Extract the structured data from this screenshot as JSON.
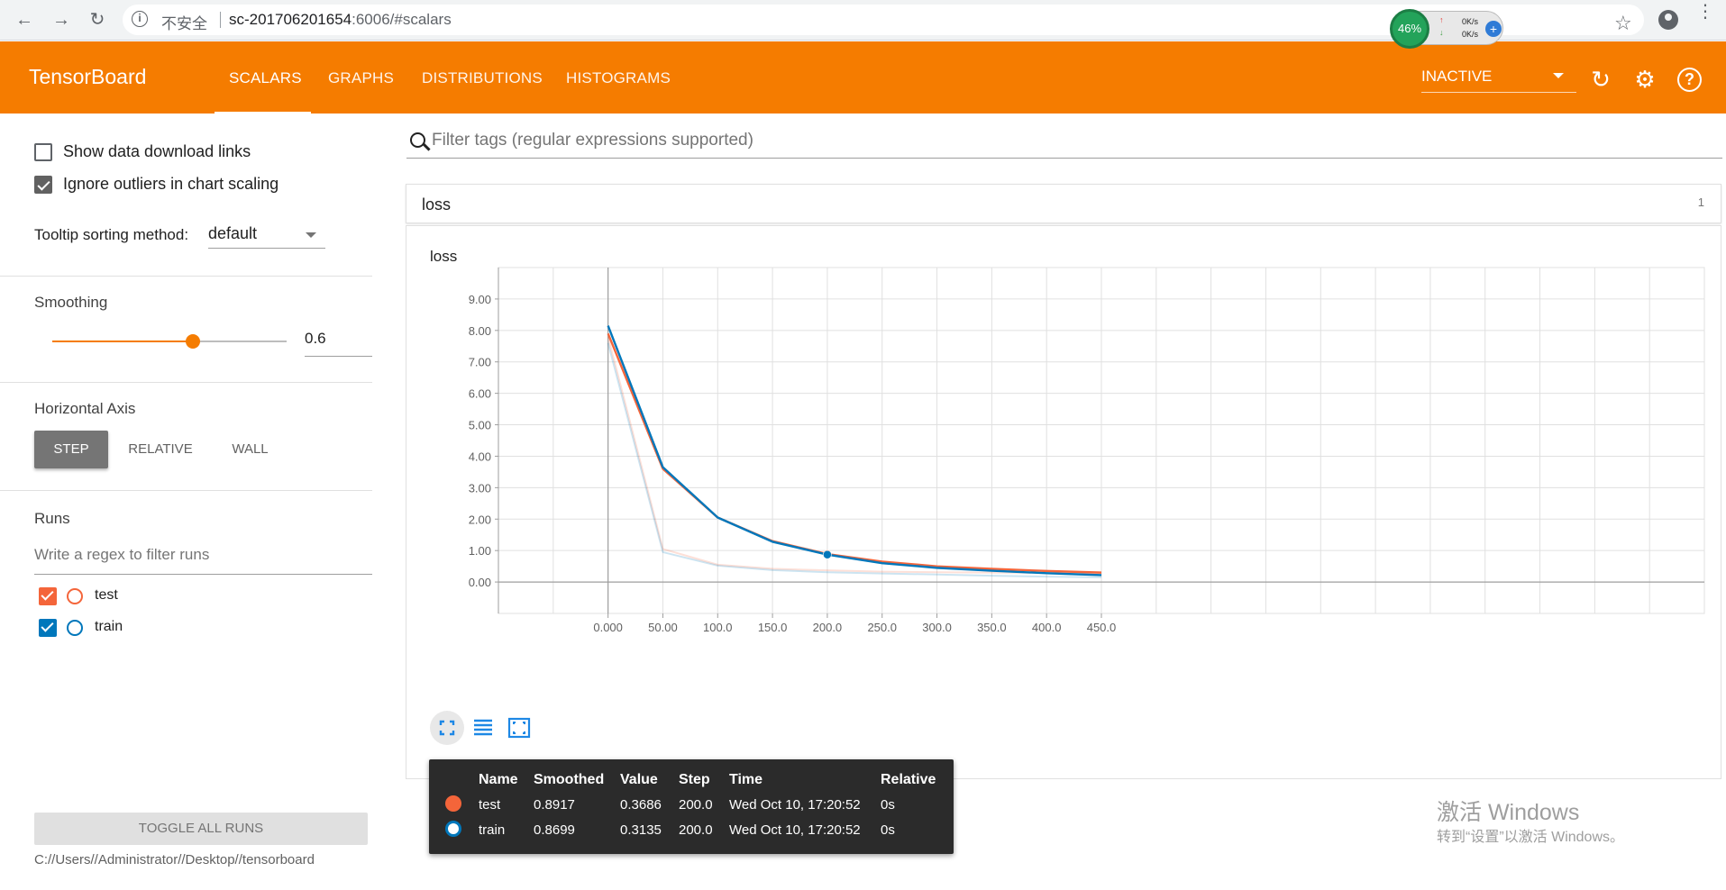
{
  "browser": {
    "insecure_label": "不安全",
    "url_host": "sc-201706201654",
    "url_rest": ":6006/#scalars",
    "net": {
      "percent": "46%",
      "up": "0K/s",
      "down": "0K/s"
    }
  },
  "header": {
    "title": "TensorBoard",
    "tabs": [
      "SCALARS",
      "GRAPHS",
      "DISTRIBUTIONS",
      "HISTOGRAMS"
    ],
    "active_tab": "SCALARS",
    "run_selector": "INACTIVE"
  },
  "sidebar": {
    "show_download_links": {
      "label": "Show data download links",
      "checked": false
    },
    "ignore_outliers": {
      "label": "Ignore outliers in chart scaling",
      "checked": true
    },
    "tooltip_sorting": {
      "label": "Tooltip sorting method:",
      "value": "default"
    },
    "smoothing": {
      "label": "Smoothing",
      "value": "0.6",
      "fraction": 0.6
    },
    "horizontal_axis": {
      "label": "Horizontal Axis",
      "options": [
        "STEP",
        "RELATIVE",
        "WALL"
      ],
      "selected": "STEP"
    },
    "runs": {
      "label": "Runs",
      "filter_placeholder": "Write a regex to filter runs",
      "items": [
        {
          "name": "test",
          "color": "#f4653a",
          "checked": true
        },
        {
          "name": "train",
          "color": "#0077bb",
          "checked": true
        }
      ]
    },
    "toggle_all": "TOGGLE ALL RUNS",
    "logdir": "C://Users//Administrator//Desktop//tensorboard"
  },
  "main": {
    "filter_placeholder": "Filter tags (regular expressions supported)",
    "category": {
      "title": "loss",
      "count": "1"
    },
    "card_title": "loss"
  },
  "chart_data": {
    "type": "line",
    "title": "loss",
    "xlabel": "",
    "ylabel": "",
    "x_ticks": [
      "0.000",
      "50.00",
      "100.0",
      "150.0",
      "200.0",
      "250.0",
      "300.0",
      "350.0",
      "400.0",
      "450.0"
    ],
    "y_ticks": [
      "0.00",
      "1.00",
      "2.00",
      "3.00",
      "4.00",
      "5.00",
      "6.00",
      "7.00",
      "8.00",
      "9.00"
    ],
    "xlim": [
      -100,
      1000
    ],
    "ylim": [
      -1,
      10
    ],
    "grid": true,
    "series": [
      {
        "name": "test",
        "color": "#f4653a",
        "kind": "smoothed",
        "x": [
          0,
          50,
          100,
          150,
          200,
          250,
          300,
          350,
          400,
          450
        ],
        "y": [
          7.9,
          3.6,
          2.05,
          1.3,
          0.89,
          0.65,
          0.5,
          0.42,
          0.35,
          0.3
        ]
      },
      {
        "name": "train",
        "color": "#0077bb",
        "kind": "smoothed",
        "x": [
          0,
          50,
          100,
          150,
          200,
          250,
          300,
          350,
          400,
          450
        ],
        "y": [
          8.15,
          3.65,
          2.05,
          1.28,
          0.87,
          0.6,
          0.45,
          0.36,
          0.28,
          0.22
        ]
      },
      {
        "name": "test",
        "color": "#f4653a",
        "kind": "raw",
        "x": [
          0,
          50,
          100,
          150,
          200,
          250,
          300,
          350,
          400,
          450
        ],
        "y": [
          7.8,
          1.05,
          0.55,
          0.42,
          0.37,
          0.33,
          0.31,
          0.3,
          0.29,
          0.28
        ]
      },
      {
        "name": "train",
        "color": "#0077bb",
        "kind": "raw",
        "x": [
          0,
          50,
          100,
          150,
          200,
          250,
          300,
          350,
          400,
          450
        ],
        "y": [
          7.6,
          0.95,
          0.52,
          0.38,
          0.31,
          0.27,
          0.24,
          0.2,
          0.17,
          0.15
        ]
      }
    ],
    "highlight_x": 200
  },
  "tooltip": {
    "headers": [
      "Name",
      "Smoothed",
      "Value",
      "Step",
      "Time",
      "Relative"
    ],
    "rows": [
      {
        "color": "#f4653a",
        "name": "test",
        "smoothed": "0.8917",
        "value": "0.3686",
        "step": "200.0",
        "time": "Wed Oct 10, 17:20:52",
        "relative": "0s"
      },
      {
        "color": "#0077bb",
        "name": "train",
        "smoothed": "0.8699",
        "value": "0.3135",
        "step": "200.0",
        "time": "Wed Oct 10, 17:20:52",
        "relative": "0s"
      }
    ]
  },
  "watermark": {
    "line1": "激活 Windows",
    "line2": "转到“设置”以激活 Windows。"
  }
}
